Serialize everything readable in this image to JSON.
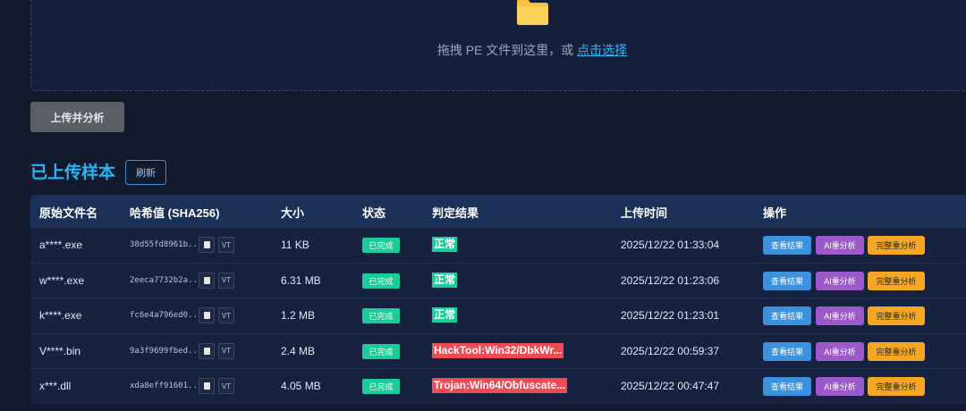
{
  "dropzone": {
    "text": "拖拽 PE 文件到这里，或 ",
    "link": "点击选择"
  },
  "upload_button": "上传并分析",
  "section": {
    "title": "已上传样本",
    "refresh": "刷新"
  },
  "table": {
    "headers": [
      "原始文件名",
      "哈希值 (SHA256)",
      "大小",
      "状态",
      "判定结果",
      "上传时间",
      "操作"
    ],
    "vt_label": "VT",
    "actions": {
      "view": "查看结果",
      "ai": "AI重分析",
      "full": "完整重分析"
    },
    "rows": [
      {
        "name": "a****.exe",
        "hash": "38d55fd8961b...",
        "size": "11 KB",
        "status": "已完成",
        "verdict": "正常",
        "verdict_type": "ok",
        "time": "2025/12/22 01:33:04"
      },
      {
        "name": "w****.exe",
        "hash": "2eeca7732b2a...",
        "size": "6.31 MB",
        "status": "已完成",
        "verdict": "正常",
        "verdict_type": "ok",
        "time": "2025/12/22 01:23:06"
      },
      {
        "name": "k****.exe",
        "hash": "fc6e4a796ed0...",
        "size": "1.2 MB",
        "status": "已完成",
        "verdict": "正常",
        "verdict_type": "ok",
        "time": "2025/12/22 01:23:01"
      },
      {
        "name": "V****.bin",
        "hash": "9a3f9699fbed...",
        "size": "2.4 MB",
        "status": "已完成",
        "verdict": "HackTool:Win32/DbkWr...",
        "verdict_type": "bad",
        "time": "2025/12/22 00:59:37"
      },
      {
        "name": "x***.dll",
        "hash": "xda8eff91601...",
        "size": "4.05 MB",
        "status": "已完成",
        "verdict": "Trojan:Win64/Obfuscate...",
        "verdict_type": "bad",
        "time": "2025/12/22 00:47:47"
      }
    ]
  },
  "colors": {
    "accent": "#29b6f6",
    "ok": "#1ccb9a",
    "bad": "#ef4b55",
    "ai": "#9b59c9",
    "full": "#f5a623"
  }
}
